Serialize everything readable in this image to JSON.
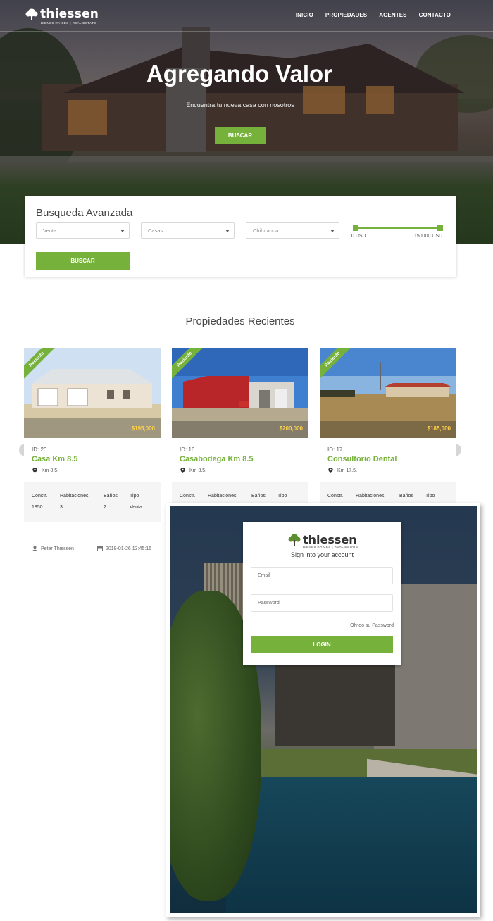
{
  "brand": {
    "name": "thiessen",
    "tagline": "BIENES RAICES | REAL ESTATE",
    "accent_color": "#76b23b"
  },
  "nav": {
    "items": [
      "INICIO",
      "PROPIEDADES",
      "AGENTES",
      "CONTACTO"
    ]
  },
  "hero": {
    "title": "Agregando Valor",
    "subtitle": "Encuentra tu nueva casa con nosotros",
    "button_label": "BUSCAR"
  },
  "search": {
    "title": "Busqueda Avanzada",
    "operation": "Venta",
    "property_type": "Casas",
    "city": "Chihuahua",
    "price_min_label": "0 USD",
    "price_max_label": "150000 USD",
    "button_label": "BUSCAR"
  },
  "recent": {
    "title": "Propiedades Recientes",
    "ribbon_label": "Reciente",
    "spec_headers": [
      "Constr.",
      "Habitaciones",
      "Baños",
      "Tipo"
    ],
    "properties": [
      {
        "price": "$195,000",
        "id": "ID: 20",
        "name": "Casa Km 8.5",
        "location": "Km 8.5,",
        "constr": "1850",
        "rooms": "3",
        "baths": "2",
        "type": "Venta",
        "agent": "Peter Thiessen",
        "date": "2019-01-26 13:45:16"
      },
      {
        "price": "$200,000",
        "id": "ID: 16",
        "name": "Casabodega Km 8.5",
        "location": "Km 8.5,",
        "constr": "",
        "rooms": "",
        "baths": "",
        "type": ""
      },
      {
        "price": "$185,000",
        "id": "ID: 17",
        "name": "Consultorio Dental",
        "location": "Km 17.5,",
        "constr": "",
        "rooms": "",
        "baths": "",
        "type": ""
      }
    ],
    "prev_icon": "‹",
    "next_icon": "›"
  },
  "login": {
    "subtitle": "Sign into your account",
    "email_placeholder": "Email",
    "password_placeholder": "Password",
    "forgot_label": "Olvido su Password",
    "button_label": "LOGIN"
  }
}
